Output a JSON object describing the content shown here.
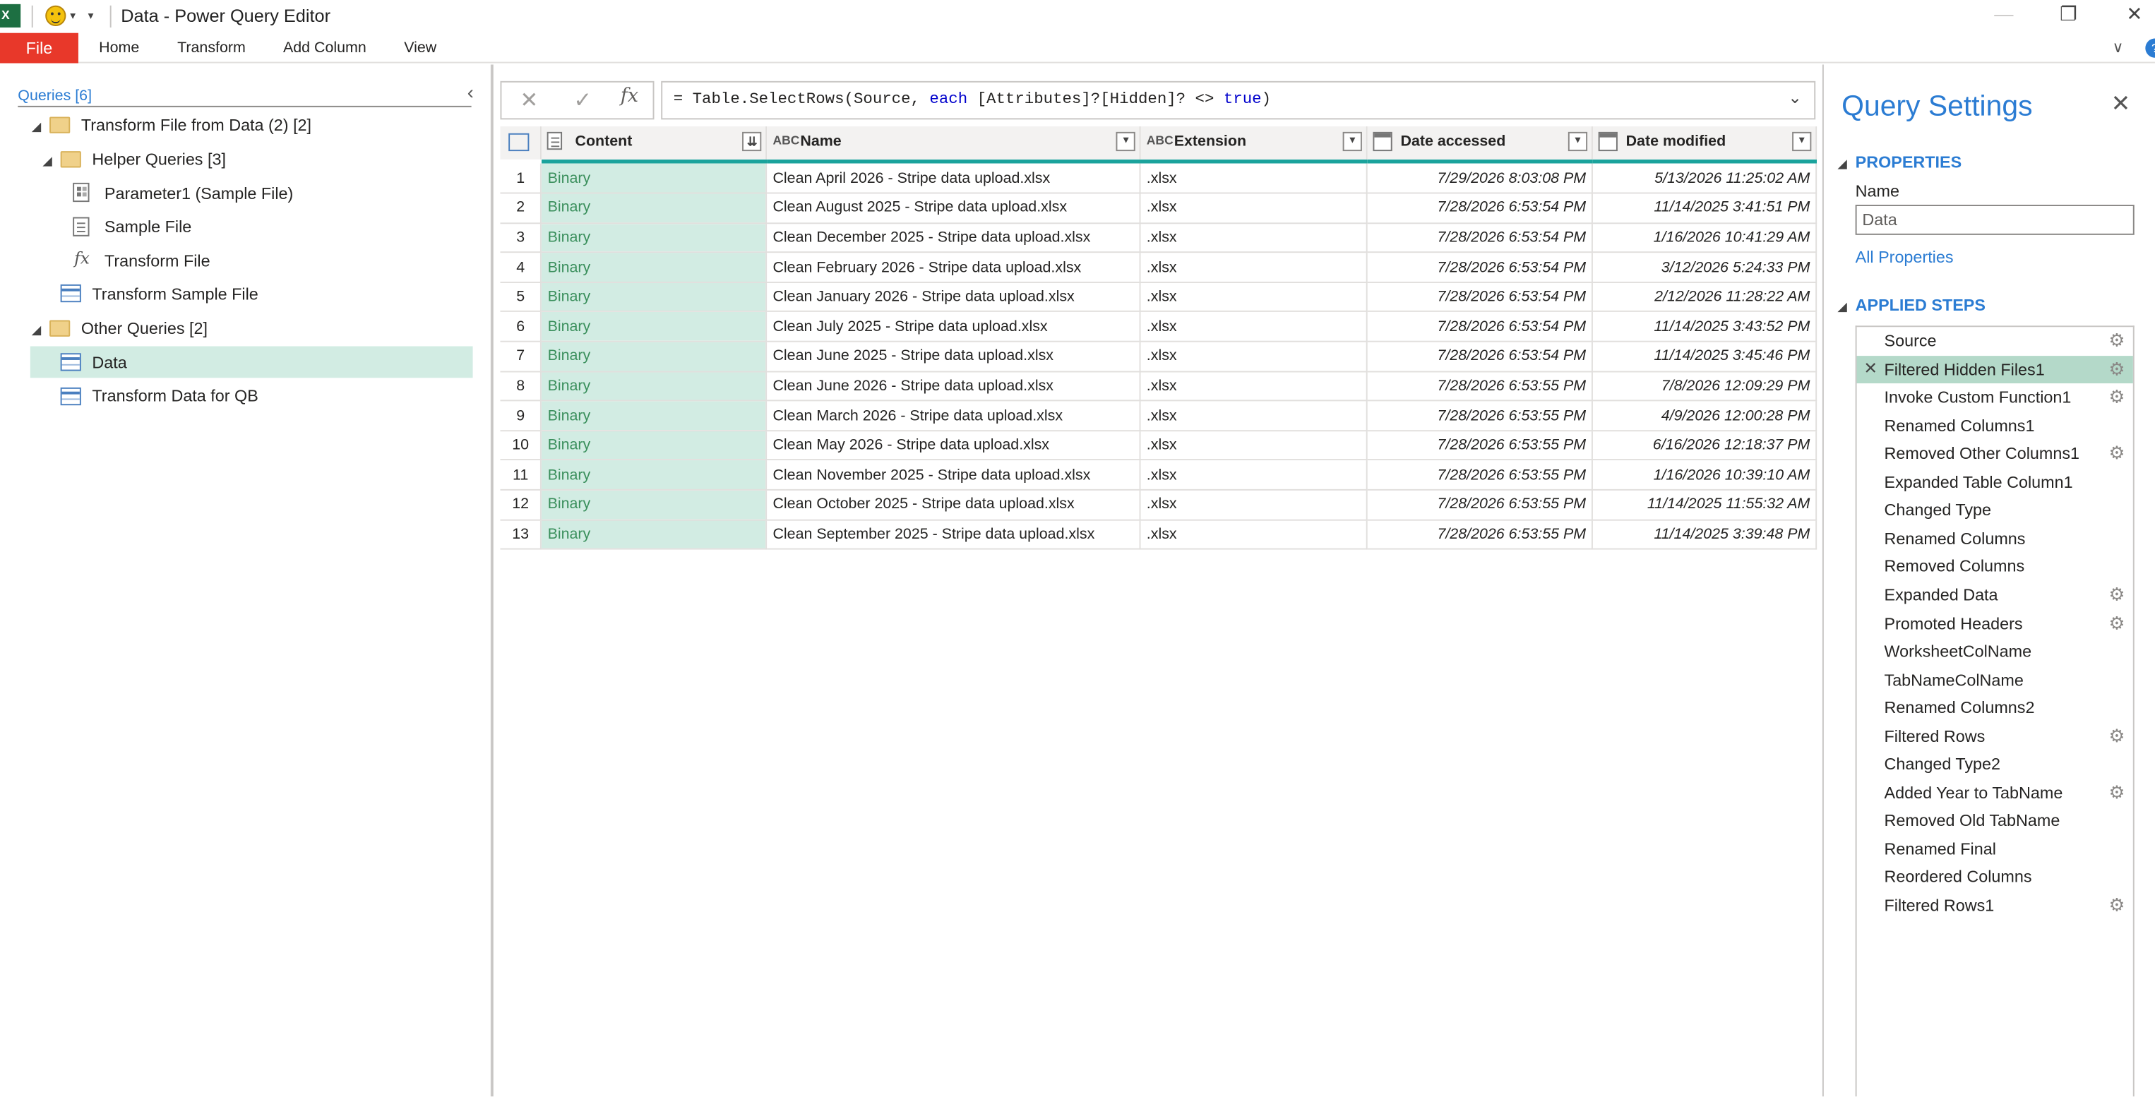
{
  "window": {
    "title": "Data - Power Query Editor",
    "app_icon": "excel-icon",
    "quick_access_icon": "smiley-icon",
    "minimize": "—",
    "restore": "❐",
    "close": "✕"
  },
  "ribbon": {
    "tabs": [
      "File",
      "Home",
      "Transform",
      "Add Column",
      "View"
    ],
    "collapse": "∨",
    "help": "?"
  },
  "queries": {
    "header": "Queries [6]",
    "collapse_icon": "‹",
    "items": [
      {
        "label": "Transform File from Data (2) [2]",
        "type": "folder"
      },
      {
        "label": "Helper Queries [3]",
        "type": "folder"
      },
      {
        "label": "Parameter1 (Sample File)",
        "type": "parameter"
      },
      {
        "label": "Sample File",
        "type": "document"
      },
      {
        "label": "Transform File",
        "type": "function"
      },
      {
        "label": "Transform Sample File",
        "type": "table"
      },
      {
        "label": "Other Queries [2]",
        "type": "folder"
      },
      {
        "label": "Data",
        "type": "table",
        "selected": true
      },
      {
        "label": "Transform Data for QB",
        "type": "table"
      }
    ]
  },
  "formula_bar": {
    "cancel": "✕",
    "commit": "✓",
    "fx": "fx",
    "formula_pre": "= Table.SelectRows(Source, ",
    "formula_kw1": "each",
    "formula_mid": " [Attributes]?[Hidden]? <> ",
    "formula_kw2": "true",
    "formula_post": ")",
    "expand": "⌄"
  },
  "grid": {
    "columns": [
      {
        "label": "Content",
        "type_icon": "binary-icon"
      },
      {
        "label": "Name",
        "type_icon": "text-type-icon"
      },
      {
        "label": "Extension",
        "type_icon": "text-type-icon"
      },
      {
        "label": "Date accessed",
        "type_icon": "datetime-icon"
      },
      {
        "label": "Date modified",
        "type_icon": "datetime-icon"
      }
    ],
    "type_text": "ABC",
    "rows": [
      {
        "n": "1",
        "content": "Binary",
        "name": "Clean April 2026 - Stripe data upload.xlsx",
        "ext": ".xlsx",
        "accessed": "7/29/2026 8:03:08 PM",
        "modified": "5/13/2026 11:25:02 AM"
      },
      {
        "n": "2",
        "content": "Binary",
        "name": "Clean August 2025 - Stripe data upload.xlsx",
        "ext": ".xlsx",
        "accessed": "7/28/2026 6:53:54 PM",
        "modified": "11/14/2025 3:41:51 PM"
      },
      {
        "n": "3",
        "content": "Binary",
        "name": "Clean December 2025 - Stripe data upload.xlsx",
        "ext": ".xlsx",
        "accessed": "7/28/2026 6:53:54 PM",
        "modified": "1/16/2026 10:41:29 AM"
      },
      {
        "n": "4",
        "content": "Binary",
        "name": "Clean February 2026 - Stripe data upload.xlsx",
        "ext": ".xlsx",
        "accessed": "7/28/2026 6:53:54 PM",
        "modified": "3/12/2026 5:24:33 PM"
      },
      {
        "n": "5",
        "content": "Binary",
        "name": "Clean January 2026 - Stripe data upload.xlsx",
        "ext": ".xlsx",
        "accessed": "7/28/2026 6:53:54 PM",
        "modified": "2/12/2026 11:28:22 AM"
      },
      {
        "n": "6",
        "content": "Binary",
        "name": "Clean July 2025 - Stripe data upload.xlsx",
        "ext": ".xlsx",
        "accessed": "7/28/2026 6:53:54 PM",
        "modified": "11/14/2025 3:43:52 PM"
      },
      {
        "n": "7",
        "content": "Binary",
        "name": "Clean June 2025 - Stripe data upload.xlsx",
        "ext": ".xlsx",
        "accessed": "7/28/2026 6:53:54 PM",
        "modified": "11/14/2025 3:45:46 PM"
      },
      {
        "n": "8",
        "content": "Binary",
        "name": "Clean June 2026 - Stripe data upload.xlsx",
        "ext": ".xlsx",
        "accessed": "7/28/2026 6:53:55 PM",
        "modified": "7/8/2026 12:09:29 PM"
      },
      {
        "n": "9",
        "content": "Binary",
        "name": "Clean March 2026 - Stripe data upload.xlsx",
        "ext": ".xlsx",
        "accessed": "7/28/2026 6:53:55 PM",
        "modified": "4/9/2026 12:00:28 PM"
      },
      {
        "n": "10",
        "content": "Binary",
        "name": "Clean May 2026 - Stripe data upload.xlsx",
        "ext": ".xlsx",
        "accessed": "7/28/2026 6:53:55 PM",
        "modified": "6/16/2026 12:18:37 PM"
      },
      {
        "n": "11",
        "content": "Binary",
        "name": "Clean November 2025 - Stripe data upload.xlsx",
        "ext": ".xlsx",
        "accessed": "7/28/2026 6:53:55 PM",
        "modified": "1/16/2026 10:39:10 AM"
      },
      {
        "n": "12",
        "content": "Binary",
        "name": "Clean October 2025 - Stripe data upload.xlsx",
        "ext": ".xlsx",
        "accessed": "7/28/2026 6:53:55 PM",
        "modified": "11/14/2025 11:55:32 AM"
      },
      {
        "n": "13",
        "content": "Binary",
        "name": "Clean September 2025 - Stripe data upload.xlsx",
        "ext": ".xlsx",
        "accessed": "7/28/2026 6:53:55 PM",
        "modified": "11/14/2025 3:39:48 PM"
      }
    ]
  },
  "settings": {
    "title": "Query Settings",
    "close": "✕",
    "properties_header": "PROPERTIES",
    "name_label": "Name",
    "name_value": "Data",
    "all_properties": "All Properties",
    "applied_steps_header": "APPLIED STEPS",
    "steps": [
      {
        "label": "Source",
        "gear": true
      },
      {
        "label": "Filtered Hidden Files1",
        "gear": true,
        "selected": true
      },
      {
        "label": "Invoke Custom Function1",
        "gear": true
      },
      {
        "label": "Renamed Columns1",
        "gear": false
      },
      {
        "label": "Removed Other Columns1",
        "gear": true
      },
      {
        "label": "Expanded Table Column1",
        "gear": false
      },
      {
        "label": "Changed Type",
        "gear": false
      },
      {
        "label": "Renamed Columns",
        "gear": false
      },
      {
        "label": "Removed Columns",
        "gear": false
      },
      {
        "label": "Expanded Data",
        "gear": true
      },
      {
        "label": "Promoted Headers",
        "gear": true
      },
      {
        "label": "WorksheetColName",
        "gear": false
      },
      {
        "label": "TabNameColName",
        "gear": false
      },
      {
        "label": "Renamed Columns2",
        "gear": false
      },
      {
        "label": "Filtered Rows",
        "gear": true
      },
      {
        "label": "Changed Type2",
        "gear": false
      },
      {
        "label": "Added Year to TabName",
        "gear": true
      },
      {
        "label": "Removed Old TabName",
        "gear": false
      },
      {
        "label": "Renamed Final",
        "gear": false
      },
      {
        "label": "Reordered Columns",
        "gear": false
      },
      {
        "label": "Filtered Rows1",
        "gear": true
      }
    ]
  },
  "colors": {
    "accent": "#2b7cd3",
    "file_tab": "#e8382a",
    "selection": "#d2ece3",
    "binary_text": "#3a8f5c"
  }
}
